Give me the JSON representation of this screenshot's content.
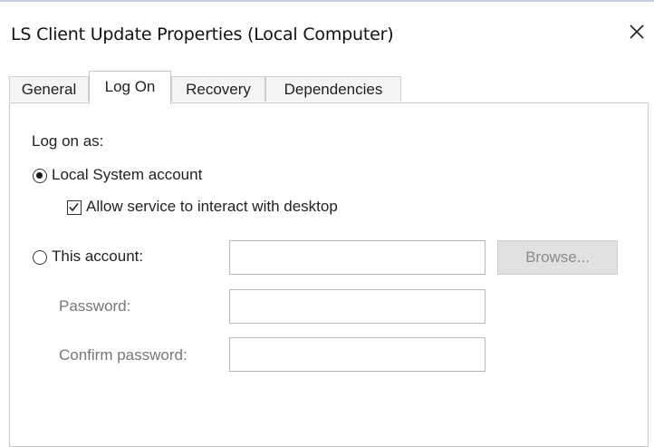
{
  "window": {
    "title": "LS Client Update Properties (Local Computer)"
  },
  "tabs": [
    {
      "label": "General",
      "active": false
    },
    {
      "label": "Log On",
      "active": true
    },
    {
      "label": "Recovery",
      "active": false
    },
    {
      "label": "Dependencies",
      "active": false
    }
  ],
  "logon": {
    "heading": "Log on as:",
    "local_system": {
      "label": "Local System account",
      "selected": true
    },
    "allow_interact": {
      "label": "Allow service to interact with desktop",
      "checked": true
    },
    "this_account": {
      "label": "This account:",
      "selected": false,
      "value": ""
    },
    "browse_label": "Browse...",
    "password": {
      "label": "Password:",
      "value": ""
    },
    "confirm_password": {
      "label": "Confirm password:",
      "value": ""
    }
  },
  "icons": {
    "close": "close-icon",
    "check": "checkmark-icon"
  }
}
